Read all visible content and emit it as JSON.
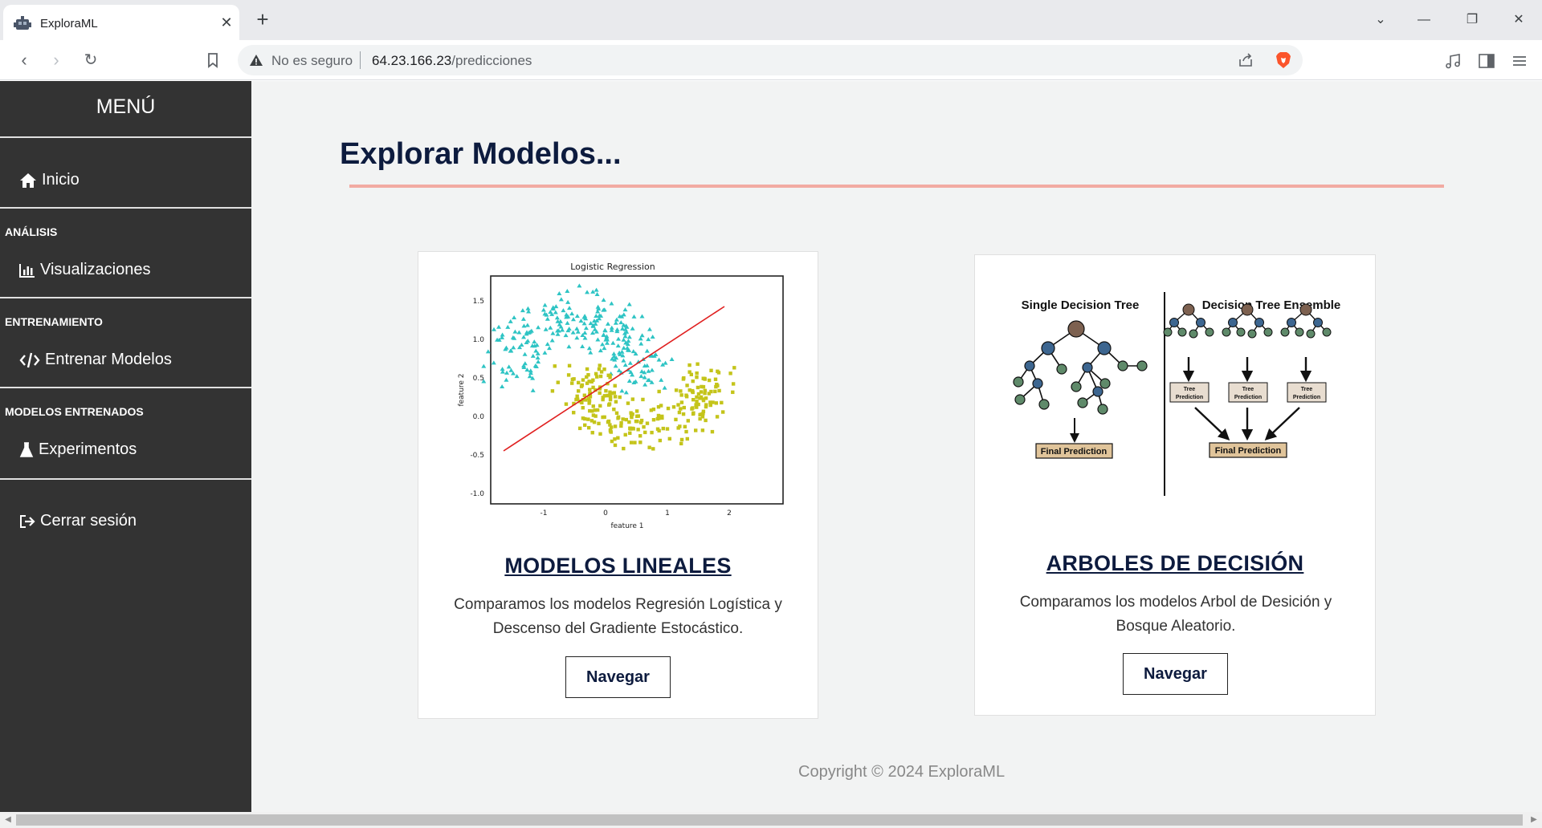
{
  "browser": {
    "tab_title": "ExploraML",
    "security_label": "No es seguro",
    "url_host": "64.23.166.23",
    "url_path": "/predicciones"
  },
  "sidebar": {
    "title": "MENÚ",
    "home": "Inicio",
    "section_analysis": "ANÁLISIS",
    "visualizations": "Visualizaciones",
    "section_training": "ENTRENAMIENTO",
    "train_models": "Entrenar Modelos",
    "section_trained": "MODELOS ENTRENADOS",
    "experiments": "Experimentos",
    "logout": "Cerrar sesión"
  },
  "main": {
    "title": "Explorar Modelos...",
    "cards": [
      {
        "heading": "MODELOS LINEALES",
        "description": "Comparamos los modelos Regresión Logística y Descenso del Gradiente Estocástico.",
        "button": "Navegar",
        "figure": {
          "title": "Logistic Regression",
          "xlabel": "feature 1",
          "ylabel": "feature 2",
          "xticks": [
            "-1",
            "0",
            "1",
            "2"
          ],
          "yticks": [
            "1.5",
            "1.0",
            "0.5",
            "0.0",
            "-0.5",
            "-1.0"
          ],
          "colors": {
            "class_a": "#2ec4c4",
            "class_b": "#c4c41a",
            "boundary": "#e02020"
          }
        }
      },
      {
        "heading": "ARBOLES DE DECISIÓN",
        "description": "Comparamos los modelos Arbol de Desición y Bosque Aleatorio.",
        "button": "Navegar",
        "figure": {
          "left_title": "Single Decision Tree",
          "right_title": "Decision Tree Ensemble",
          "final_label": "Final Prediction",
          "tree_pred_line1": "Tree",
          "tree_pred_line2": "Prediction"
        }
      }
    ],
    "copyright": "Copyright © 2024 ExploraML"
  }
}
